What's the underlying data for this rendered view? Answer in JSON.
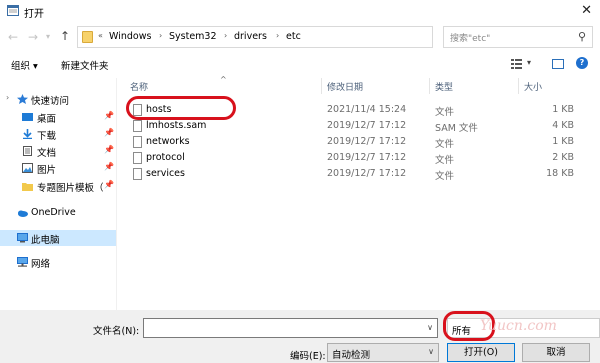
{
  "window": {
    "title": "打开"
  },
  "address": {
    "crumbs": [
      "Windows",
      "System32",
      "drivers",
      "etc"
    ]
  },
  "search": {
    "placeholder": "搜索\"etc\""
  },
  "toolbar": {
    "organize": "组织 ▾",
    "new_folder": "新建文件夹"
  },
  "sidebar": {
    "items": [
      {
        "label": "快速访问",
        "icon": "star-icon"
      },
      {
        "label": "桌面",
        "icon": "desktop-icon",
        "pinned": true
      },
      {
        "label": "下载",
        "icon": "download-icon",
        "pinned": true
      },
      {
        "label": "文档",
        "icon": "document-icon",
        "pinned": true
      },
      {
        "label": "图片",
        "icon": "picture-icon",
        "pinned": true
      },
      {
        "label": "专题图片模板（",
        "icon": "folder-icon",
        "pinned": true
      },
      {
        "label": "OneDrive",
        "icon": "cloud-icon"
      },
      {
        "label": "此电脑",
        "icon": "computer-icon",
        "selected": true
      },
      {
        "label": "网络",
        "icon": "network-icon"
      }
    ]
  },
  "columns": {
    "name": "名称",
    "date": "修改日期",
    "type": "类型",
    "size": "大小"
  },
  "files": [
    {
      "name": "hosts",
      "date": "2021/11/4 15:24",
      "type": "文件",
      "size": "1 KB"
    },
    {
      "name": "lmhosts.sam",
      "date": "2019/12/7 17:12",
      "type": "SAM 文件",
      "size": "4 KB"
    },
    {
      "name": "networks",
      "date": "2019/12/7 17:12",
      "type": "文件",
      "size": "1 KB"
    },
    {
      "name": "protocol",
      "date": "2019/12/7 17:12",
      "type": "文件",
      "size": "2 KB"
    },
    {
      "name": "services",
      "date": "2019/12/7 17:12",
      "type": "文件",
      "size": "18 KB"
    }
  ],
  "bottom": {
    "filename_label": "文件名(N):",
    "filename_value": "",
    "filter": "所有",
    "encoding_label": "编码(E):",
    "encoding_value": "自动检测",
    "open_button": "打开(O)",
    "cancel_button": "取消"
  },
  "watermark": "Yuucn.com",
  "colors": {
    "annotation": "#d8111c",
    "selected": "#cce8ff",
    "accent": "#0078d7"
  }
}
